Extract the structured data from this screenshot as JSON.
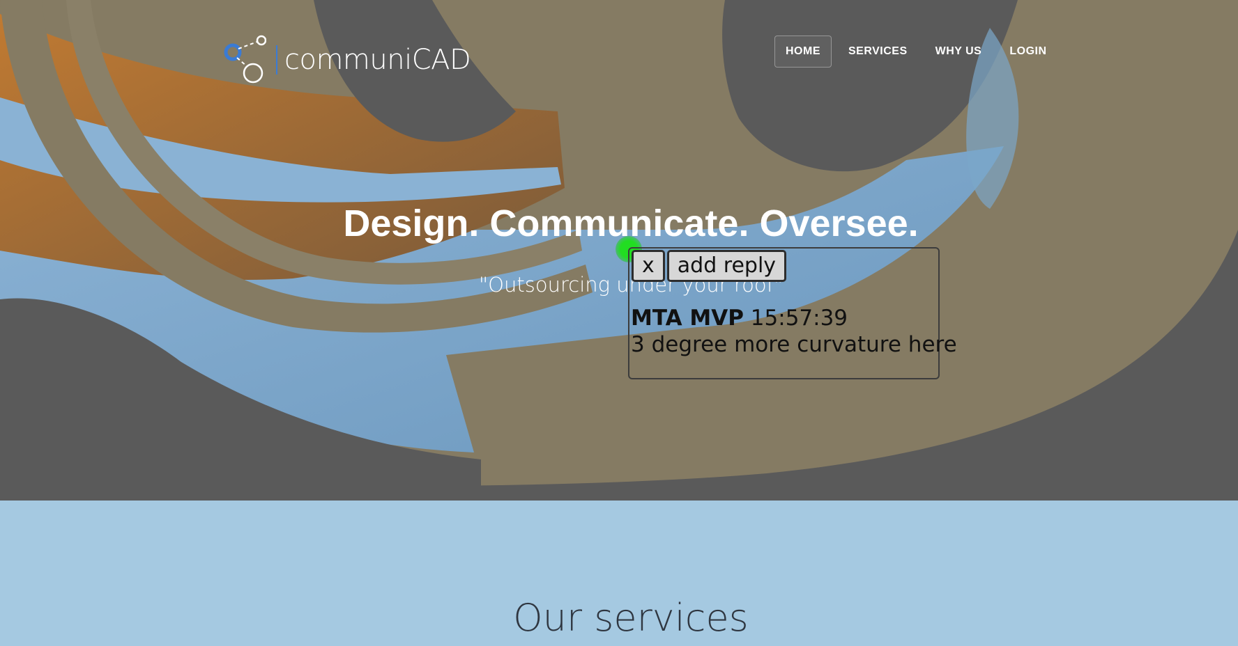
{
  "brand": {
    "name": "communiCAD",
    "icon": "network-nodes-logo-icon"
  },
  "nav": {
    "items": [
      {
        "label": "HOME",
        "active": true
      },
      {
        "label": "SERVICES",
        "active": false
      },
      {
        "label": "WHY US",
        "active": false
      },
      {
        "label": "LOGIN",
        "active": false
      }
    ]
  },
  "hero": {
    "title": "Design. Communicate. Oversee.",
    "subtitle": "\"Outsourcing under your roof\""
  },
  "annotation": {
    "close_label": "x",
    "reply_label": "add reply",
    "author": "MTA MVP",
    "time": "15:57:39",
    "text": "3 degree more curvature here",
    "marker_color": "#22dd22"
  },
  "services": {
    "title": "Our services"
  },
  "colors": {
    "services_bg": "#a5c9e1",
    "accent": "#3a7bd5",
    "model_tan": "#857b63",
    "model_blue": "#7aa6c9",
    "model_orange": "#b06f2c"
  }
}
